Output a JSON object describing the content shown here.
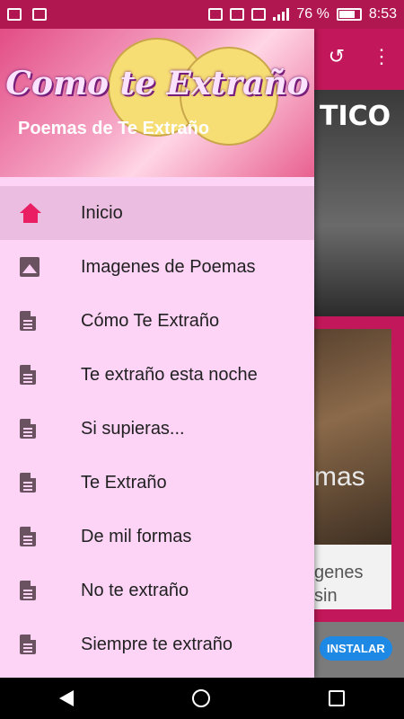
{
  "status_bar": {
    "battery_percent": "76 %",
    "time": "8:53",
    "icons": [
      "gmail-icon",
      "photo-icon",
      "nfc-icon",
      "mute-icon",
      "wifi-icon",
      "signal-icon",
      "battery-icon"
    ]
  },
  "drawer": {
    "header_logo": "Como te Extraño",
    "header_title": "Poemas de Te Extraño",
    "items": [
      {
        "label": "Inicio",
        "icon": "home-icon",
        "active": true
      },
      {
        "label": "Imagenes de Poemas",
        "icon": "image-icon"
      },
      {
        "label": "Cómo Te Extraño",
        "icon": "document-icon"
      },
      {
        "label": "Te extraño esta noche",
        "icon": "document-icon"
      },
      {
        "label": "Si supieras...",
        "icon": "document-icon"
      },
      {
        "label": "Te Extraño",
        "icon": "document-icon"
      },
      {
        "label": "De mil formas",
        "icon": "document-icon"
      },
      {
        "label": "No te extraño",
        "icon": "document-icon"
      },
      {
        "label": "Siempre te extraño",
        "icon": "document-icon"
      }
    ]
  },
  "background": {
    "hero_text": "TICO",
    "card_title_fragment": "mas",
    "card_desc_line1": "genes",
    "card_desc_line2": "sin",
    "install_button": "INSTALAR"
  },
  "colors": {
    "primary": "#c2185b",
    "drawer_bg": "#fdd3f6",
    "active_item_bg": "#ebbde1",
    "accent_home": "#e91e63",
    "install_blue": "#1e88e5"
  }
}
